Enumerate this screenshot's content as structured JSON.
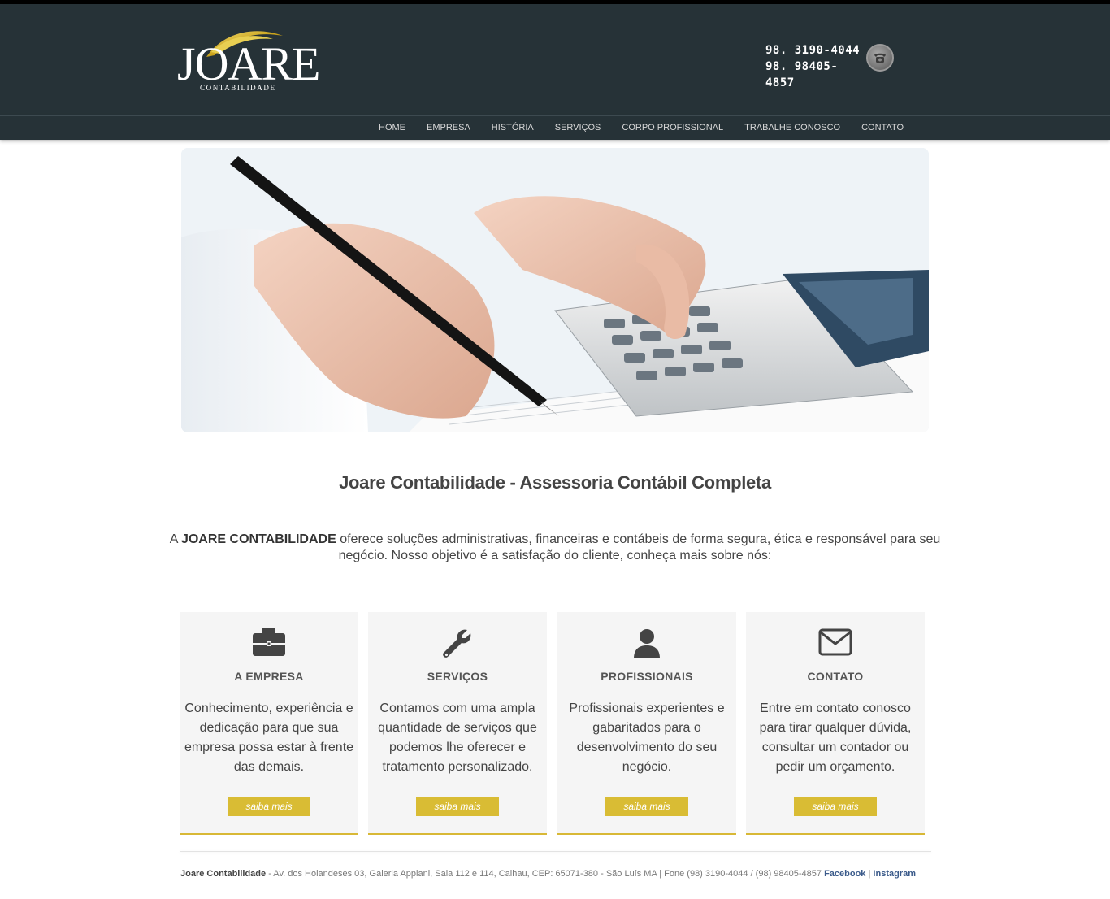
{
  "brand": {
    "name": "JOARE",
    "subtitle": "CONTABILIDADE"
  },
  "header": {
    "phones": [
      "98.  3190-4044",
      "98. 98405-4857"
    ],
    "phone_icon": "telephone-icon"
  },
  "nav": {
    "items": [
      {
        "label": "HOME"
      },
      {
        "label": "EMPRESA"
      },
      {
        "label": "HISTÓRIA"
      },
      {
        "label": "SERVIÇOS"
      },
      {
        "label": "CORPO PROFISSIONAL"
      },
      {
        "label": "TRABALHE CONOSCO"
      },
      {
        "label": "CONTATO"
      }
    ]
  },
  "main": {
    "title": "Joare Contabilidade - Assessoria Contábil Completa",
    "intro_prefix": "A ",
    "intro_brand": "JOARE CONTABILIDADE",
    "intro_rest": " oferece soluções administrativas, financeiras e contábeis de forma segura, ética e responsável para seu negócio. Nosso objetivo é a satisfação do cliente, conheça mais sobre nós:"
  },
  "cards": [
    {
      "icon": "briefcase-icon",
      "title": "A EMPRESA",
      "text": "Conhecimento, experiência e dedicação para que sua empresa possa estar à frente das demais.",
      "button": "saiba mais"
    },
    {
      "icon": "wrench-icon",
      "title": "SERVIÇOS",
      "text": "Contamos com uma ampla quantidade de serviços que podemos lhe oferecer e tratamento personalizado.",
      "button": "saiba mais"
    },
    {
      "icon": "user-icon",
      "title": "PROFISSIONAIS",
      "text": "Profissionais experientes e gabaritados para o desenvolvimento do seu negócio.",
      "button": "saiba mais"
    },
    {
      "icon": "envelope-icon",
      "title": "CONTATO",
      "text": "Entre em contato conosco para tirar qualquer dúvida, consultar um contador ou pedir um orçamento.",
      "button": "saiba mais"
    }
  ],
  "footer": {
    "company": "Joare Contabilidade",
    "address": " - Av. dos Holandeses 03, Galeria Appiani, Sala 112 e 114, Calhau, CEP: 65071-380 - São Luís MA | Fone (98) 3190-4044 / (98) 98405-4857  ",
    "facebook": "Facebook",
    "separator": " | ",
    "instagram": "Instagram"
  },
  "colors": {
    "header_bg": "#263237",
    "accent_gold": "#d9bc34",
    "card_bg": "#f5f5f5"
  }
}
